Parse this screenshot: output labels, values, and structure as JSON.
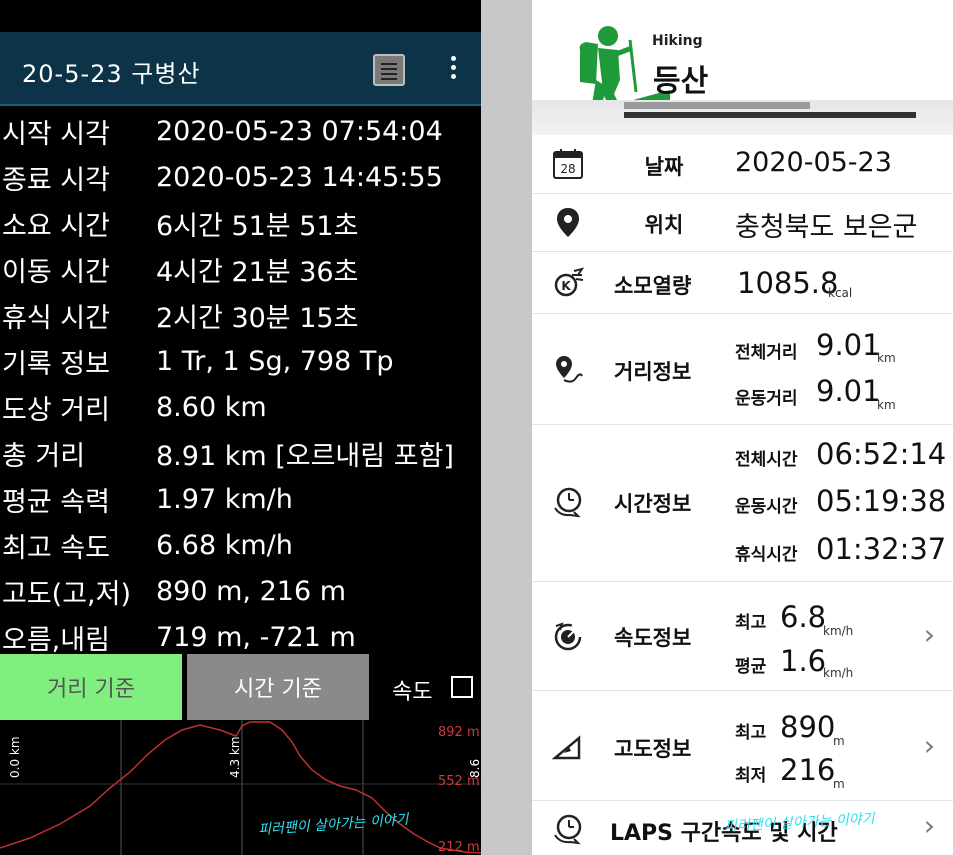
{
  "left": {
    "title": "20-5-23  구병산",
    "rows": [
      {
        "label": "시작 시각",
        "value": "2020-05-23 07:54:04"
      },
      {
        "label": "종료 시각",
        "value": "2020-05-23 14:45:55"
      },
      {
        "label": "소요 시간",
        "value": "6시간 51분 51초"
      },
      {
        "label": "이동 시간",
        "value": "4시간 21분 36초"
      },
      {
        "label": "휴식 시간",
        "value": "2시간 30분 15초"
      },
      {
        "label": "기록 정보",
        "value": "1 Tr, 1 Sg, 798 Tp"
      },
      {
        "label": "도상 거리",
        "value": "8.60 km"
      },
      {
        "label": "총 거리",
        "value": "8.91 km [오르내림 포함]"
      },
      {
        "label": "평균 속력",
        "value": "1.97 km/h"
      },
      {
        "label": "최고 속도",
        "value": "6.68 km/h"
      },
      {
        "label": "고도(고,저)",
        "value": "890 m, 216 m"
      },
      {
        "label": "오름,내림",
        "value": "719 m, -721 m"
      }
    ],
    "tab_distance": "거리 기준",
    "tab_time": "시간 기준",
    "speed_label": "속도",
    "graph": {
      "y_labels": [
        "892 m",
        "552 m",
        "212 m"
      ],
      "x_labels": [
        "0.0 km",
        "4.3 km",
        "8.6 km"
      ],
      "watermark": "피러팬이 살아가는 이야기"
    }
  },
  "right": {
    "header_en": "Hiking",
    "header_ko": "등산",
    "date": {
      "label": "날짜",
      "value": "2020-05-23"
    },
    "location": {
      "label": "위치",
      "value": "충청북도 보은군"
    },
    "calories": {
      "label": "소모열량",
      "value": "1085.8",
      "unit": "kcal"
    },
    "distance": {
      "label": "거리정보",
      "total_label": "전체거리",
      "total": "9.01",
      "move_label": "운동거리",
      "move": "9.01",
      "unit": "km"
    },
    "time": {
      "label": "시간정보",
      "total_label": "전체시간",
      "total": "06:52:14",
      "move_label": "운동시간",
      "move": "05:19:38",
      "rest_label": "휴식시간",
      "rest": "01:32:37"
    },
    "speed": {
      "label": "속도정보",
      "max_label": "최고",
      "max": "6.8",
      "avg_label": "평균",
      "avg": "1.6",
      "unit": "km/h"
    },
    "altitude": {
      "label": "고도정보",
      "max_label": "최고",
      "max": "890",
      "min_label": "최저",
      "min": "216",
      "unit": "m"
    },
    "laps": {
      "label": "LAPS 구간속도 및 시간"
    },
    "watermark": "피러팬이 살아가는 이야기",
    "calendar_day": "28",
    "colors": {
      "accent_green": "#1f9a3b"
    }
  }
}
